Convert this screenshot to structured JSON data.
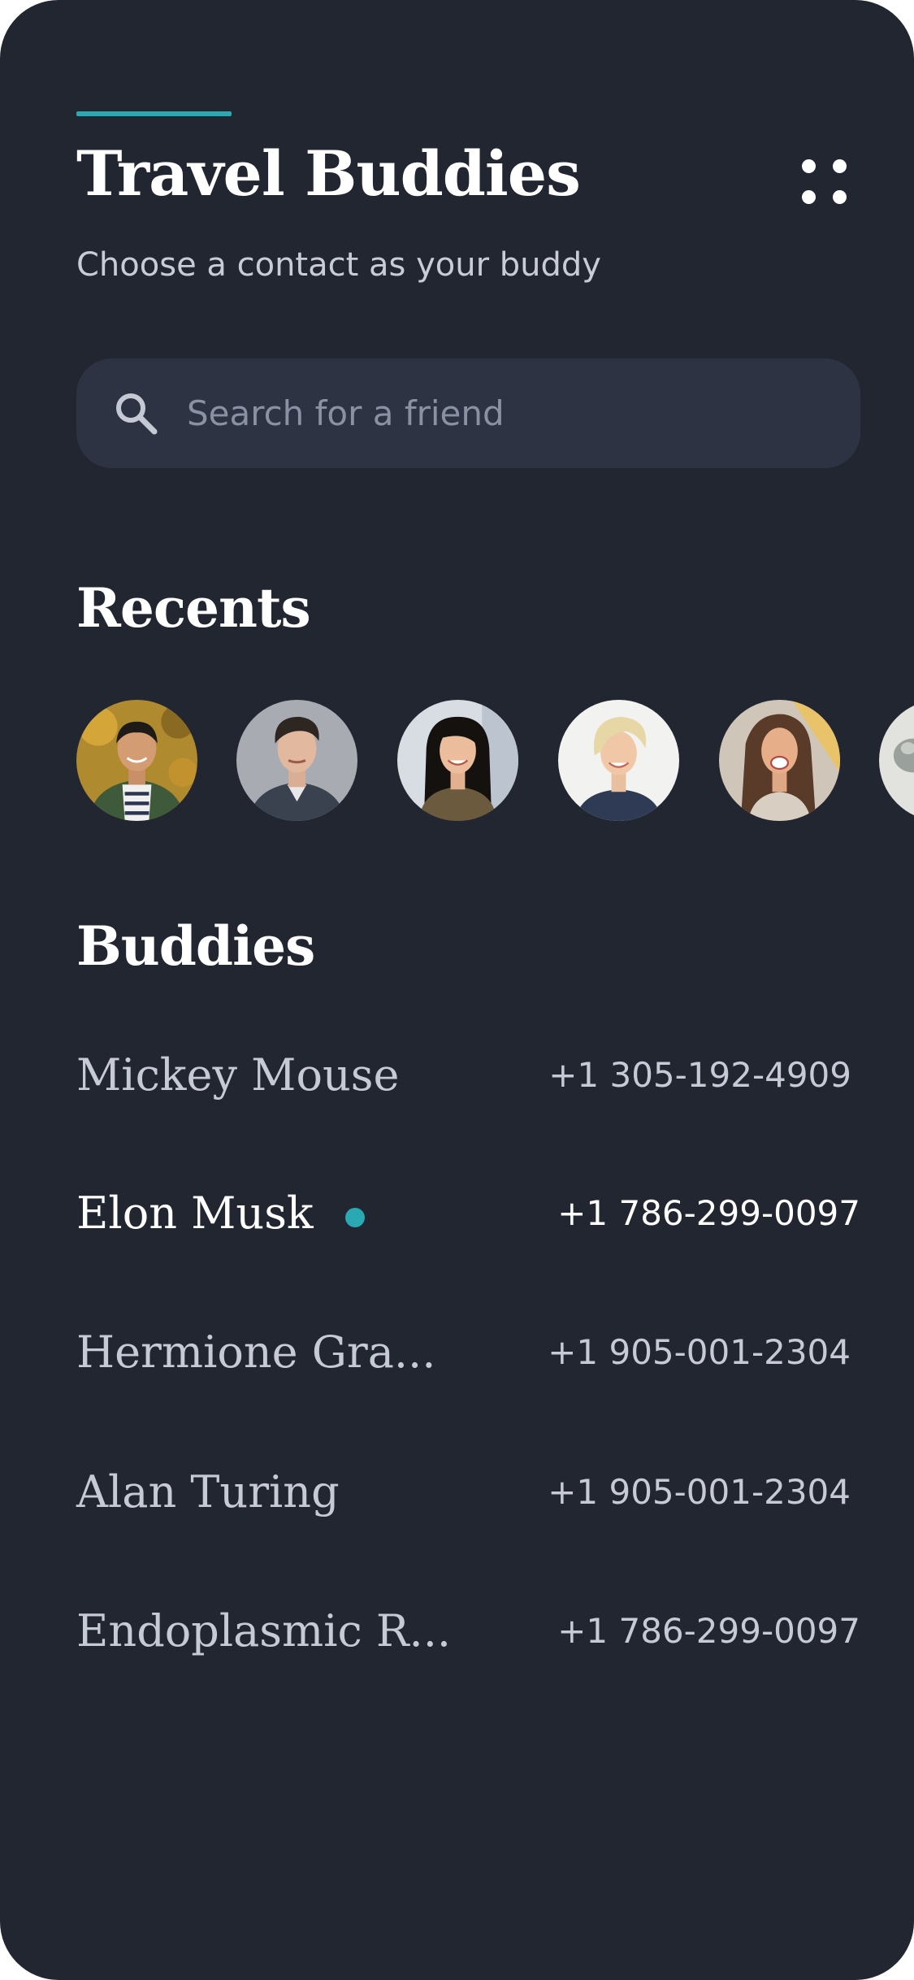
{
  "header": {
    "title": "Travel Buddies",
    "subtitle": "Choose a contact as your buddy",
    "menu_icon": "grid-dots-icon"
  },
  "search": {
    "placeholder": "Search for a friend",
    "value": "",
    "icon": "search-icon"
  },
  "recents": {
    "title": "Recents",
    "avatars": [
      "avatar-1",
      "avatar-2",
      "avatar-3",
      "avatar-4",
      "avatar-5",
      "avatar-6"
    ]
  },
  "buddies": {
    "title": "Buddies",
    "items": [
      {
        "name": "Mickey Mouse",
        "phone": "+1 305-192-4909",
        "online": false
      },
      {
        "name": "Elon Musk",
        "phone": "+1 786-299-0097",
        "online": true
      },
      {
        "name": "Hermione Gra...",
        "phone": "+1 905-001-2304",
        "online": false
      },
      {
        "name": "Alan Turing",
        "phone": "+1 905-001-2304",
        "online": false
      },
      {
        "name": "Endoplasmic R...",
        "phone": "+1 786-299-0097",
        "online": false
      }
    ]
  },
  "colors": {
    "background": "#222630",
    "accent": "#2ba9b3",
    "search_background": "#2d3342"
  }
}
